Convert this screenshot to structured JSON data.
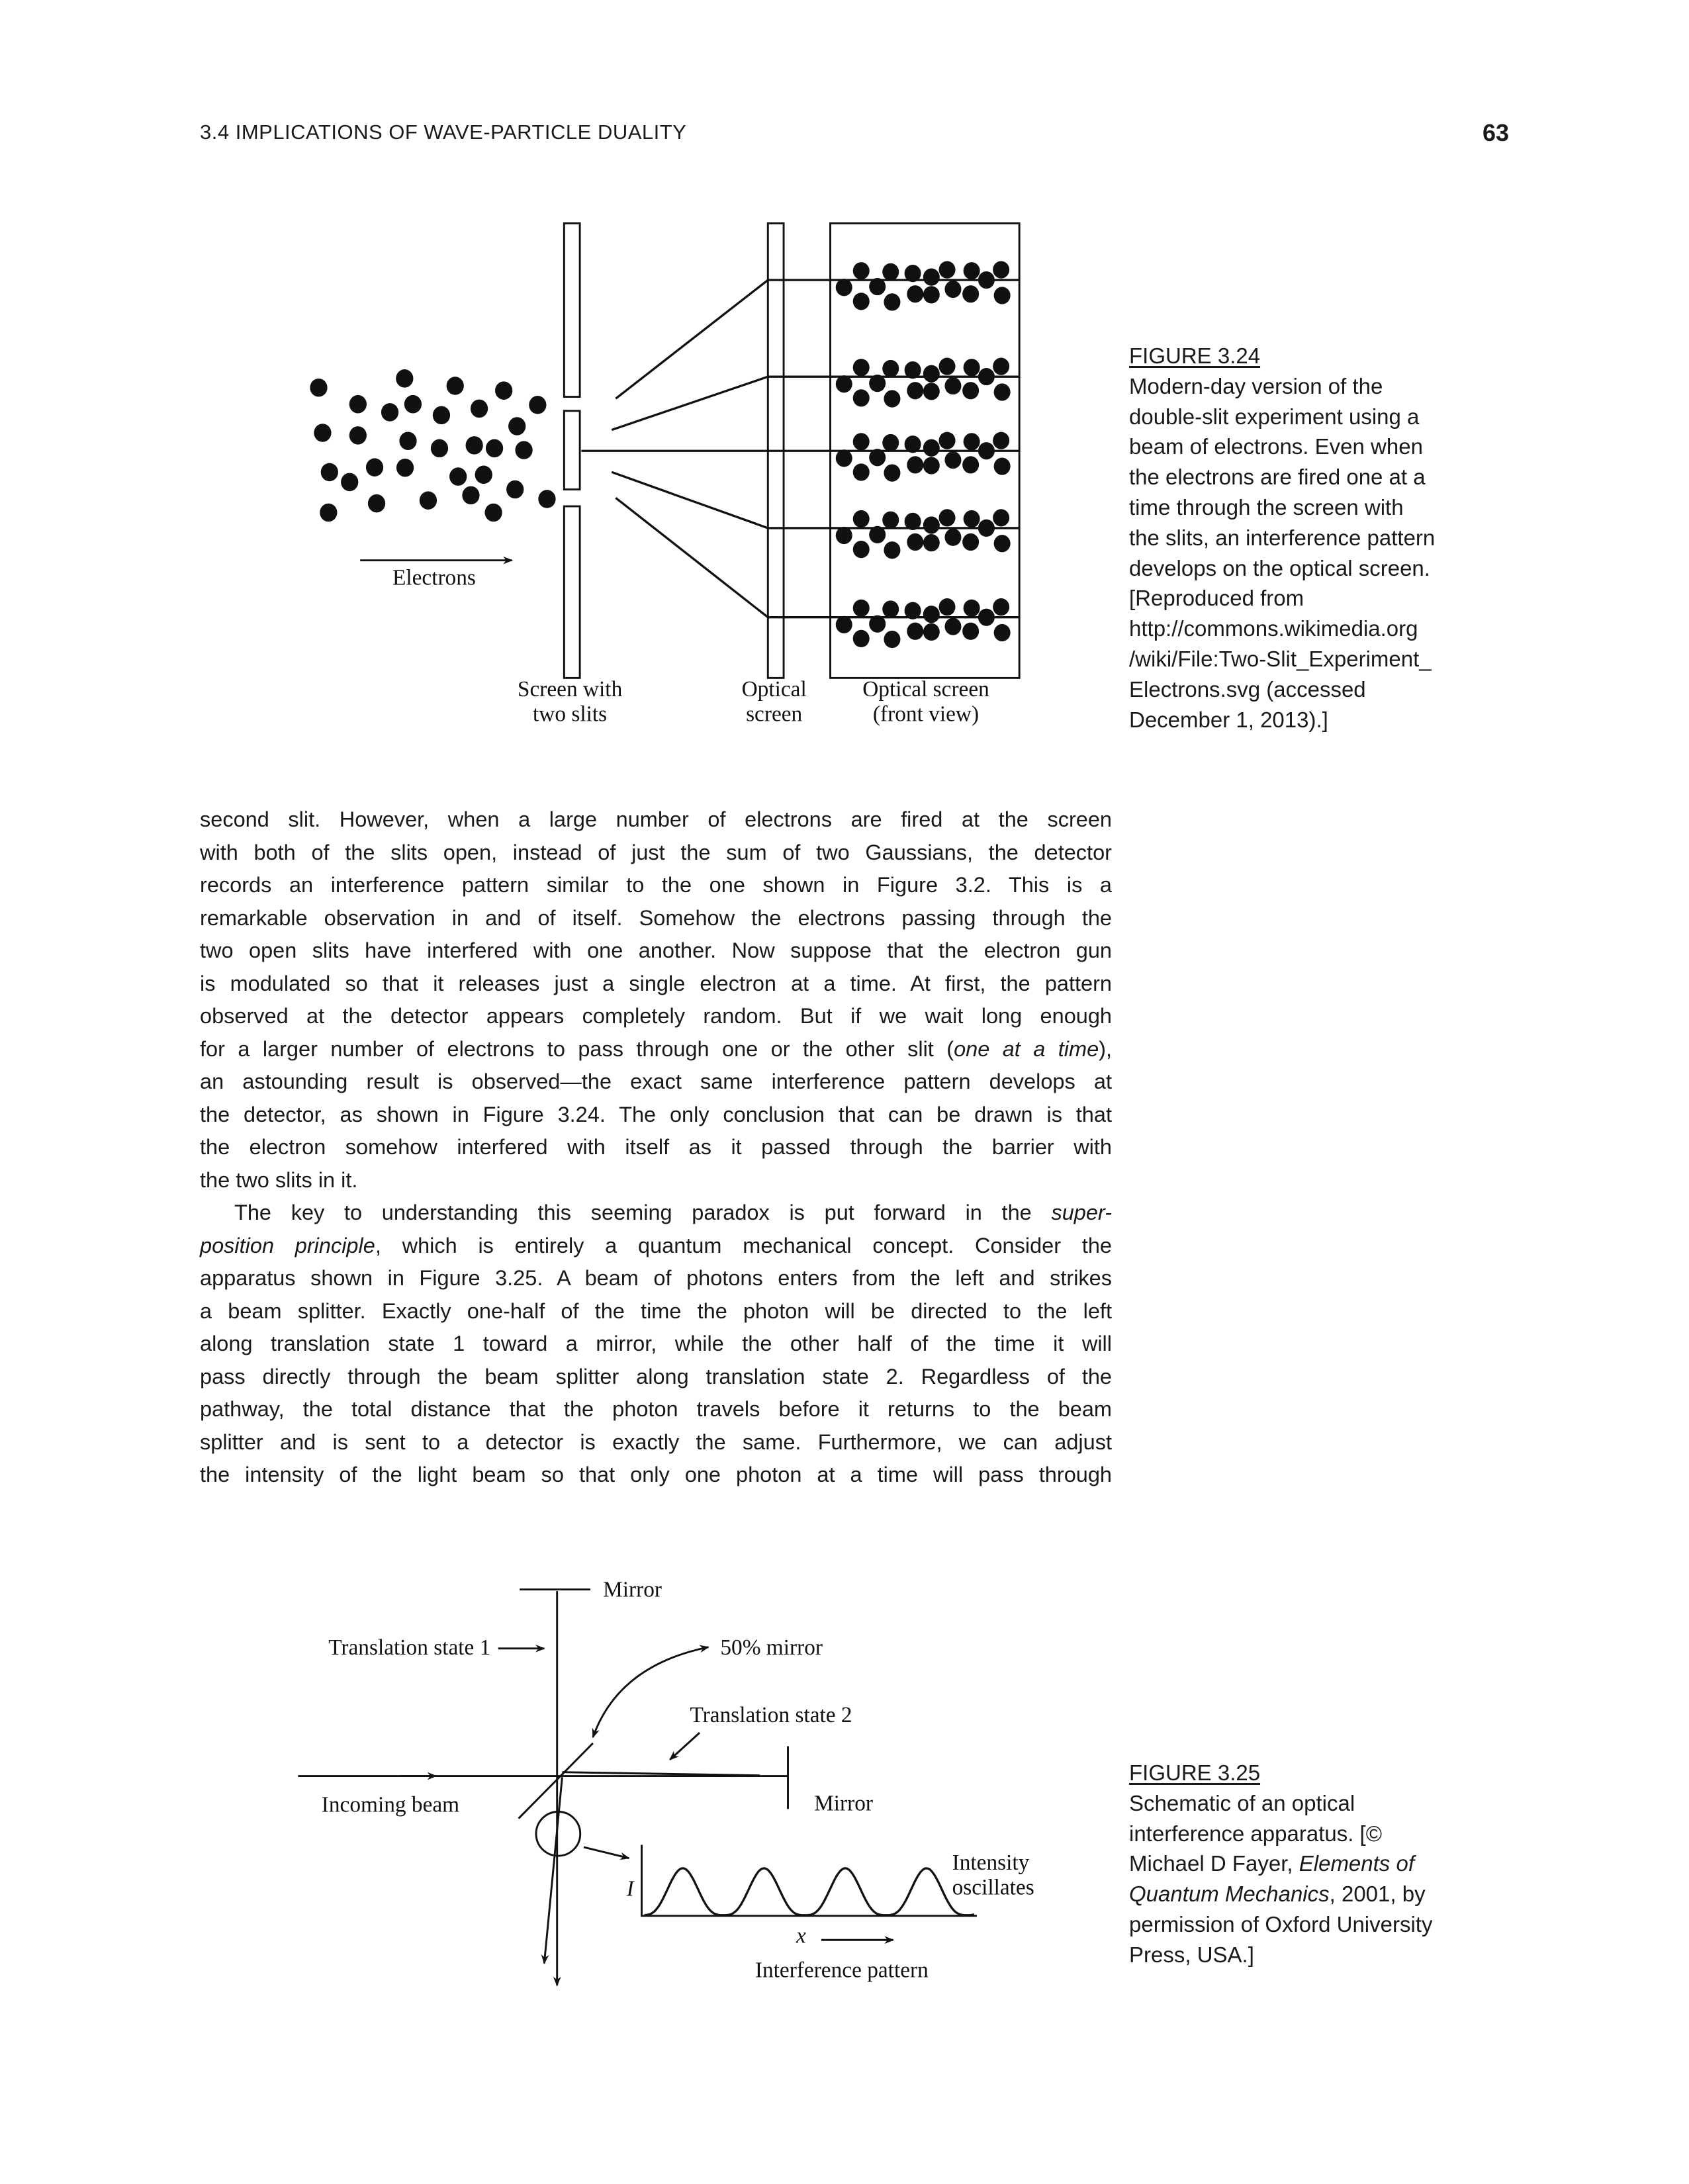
{
  "header": {
    "running_head": "3.4 IMPLICATIONS OF WAVE-PARTICLE DUALITY",
    "page_number": "63"
  },
  "figure_3_24": {
    "labels": {
      "electrons": "Electrons",
      "screen_with": "Screen with",
      "two_slits": "two slits",
      "optical": "Optical",
      "screen": "screen",
      "optical_screen": "Optical screen",
      "front_view": "(front view)"
    },
    "caption": {
      "label": "FIGURE 3.24",
      "lines": [
        [
          {
            "t": "Modern-day version of the"
          }
        ],
        [
          {
            "t": "double-slit experiment using a"
          }
        ],
        [
          {
            "t": "beam of electrons. Even when"
          }
        ],
        [
          {
            "t": "the electrons are fired one at a"
          }
        ],
        [
          {
            "t": "time through the screen with"
          }
        ],
        [
          {
            "t": "the slits, an interference pattern"
          }
        ],
        [
          {
            "t": "develops on the optical screen."
          }
        ],
        [
          {
            "t": "[Reproduced from"
          }
        ],
        [
          {
            "t": "http://commons.wikimedia.org"
          }
        ],
        [
          {
            "t": "/wiki/File:Two-Slit_Experiment_"
          }
        ],
        [
          {
            "t": "Electrons.svg (accessed"
          }
        ],
        [
          {
            "t": "December 1, 2013).]"
          }
        ]
      ]
    }
  },
  "body": {
    "lines": [
      [
        {
          "t": "second slit. However, when a large number of electrons are fired at the screen"
        }
      ],
      [
        {
          "t": "with both of the slits open, instead of just the sum of two Gaussians, the detector"
        }
      ],
      [
        {
          "t": "records an interference pattern similar to the one shown in Figure 3.2. This is a"
        }
      ],
      [
        {
          "t": "remarkable observation in and of itself. Somehow the electrons passing through the"
        }
      ],
      [
        {
          "t": "two open slits have interfered with one another. Now suppose that the electron gun"
        }
      ],
      [
        {
          "t": "is modulated so that it releases just a single electron at a time. At first, the pattern"
        }
      ],
      [
        {
          "t": "observed at the detector appears completely random. But if we wait long enough"
        }
      ],
      [
        {
          "t": "for a larger number of electrons to pass through one or the other slit ("
        },
        {
          "t": "one at a time",
          "i": true
        },
        {
          "t": "),"
        }
      ],
      [
        {
          "t": "an astounding result is observed—the exact same interference pattern develops at"
        }
      ],
      [
        {
          "t": "the detector, as shown in Figure 3.24. The only conclusion that can be drawn is that"
        }
      ],
      [
        {
          "t": "the electron somehow interfered with itself as it passed through the barrier with"
        }
      ],
      [
        {
          "t": "the two slits in it."
        }
      ],
      [
        {
          "t": "The key to understanding this seeming paradox is put forward in the "
        },
        {
          "t": "super-",
          "i": true
        }
      ],
      [
        {
          "t": "position principle",
          "i": true
        },
        {
          "t": ", which is entirely a quantum mechanical concept. Consider the"
        }
      ],
      [
        {
          "t": "apparatus shown in Figure 3.25. A beam of photons enters from the left and strikes"
        }
      ],
      [
        {
          "t": "a beam splitter. Exactly one-half of the time the photon will be directed to the left"
        }
      ],
      [
        {
          "t": "along translation state 1 toward a mirror, while the other half of the time it will"
        }
      ],
      [
        {
          "t": "pass directly through the beam splitter along translation state 2. Regardless of the"
        }
      ],
      [
        {
          "t": "pathway, the total distance that the photon travels before it returns to the beam"
        }
      ],
      [
        {
          "t": "splitter and is sent to a detector is exactly the same. Furthermore, we can adjust"
        }
      ],
      [
        {
          "t": "the intensity of the light beam so that only one photon at a time will pass through"
        }
      ]
    ]
  },
  "figure_3_25": {
    "labels": {
      "mirror_top": "Mirror",
      "translation_state_1": "Translation state 1",
      "fifty_mirror": "50% mirror",
      "translation_state_2": "Translation state 2",
      "incoming_beam": "Incoming beam",
      "mirror_right": "Mirror",
      "intensity_axis": "I",
      "intensity_oscillates_1": "Intensity",
      "intensity_oscillates_2": "oscillates",
      "x_axis": "x",
      "interference_pattern": "Interference pattern"
    },
    "caption": {
      "label": "FIGURE 3.25",
      "lines": [
        [
          {
            "t": "Schematic of an optical"
          }
        ],
        [
          {
            "t": "interference apparatus. [©"
          }
        ],
        [
          {
            "t": "Michael D Fayer, "
          },
          {
            "t": "Elements of",
            "i": true
          }
        ],
        [
          {
            "t": "Quantum Mechanics",
            "i": true
          },
          {
            "t": ", 2001, by"
          }
        ],
        [
          {
            "t": "permission of Oxford University"
          }
        ],
        [
          {
            "t": "Press, USA.]"
          }
        ]
      ]
    }
  }
}
